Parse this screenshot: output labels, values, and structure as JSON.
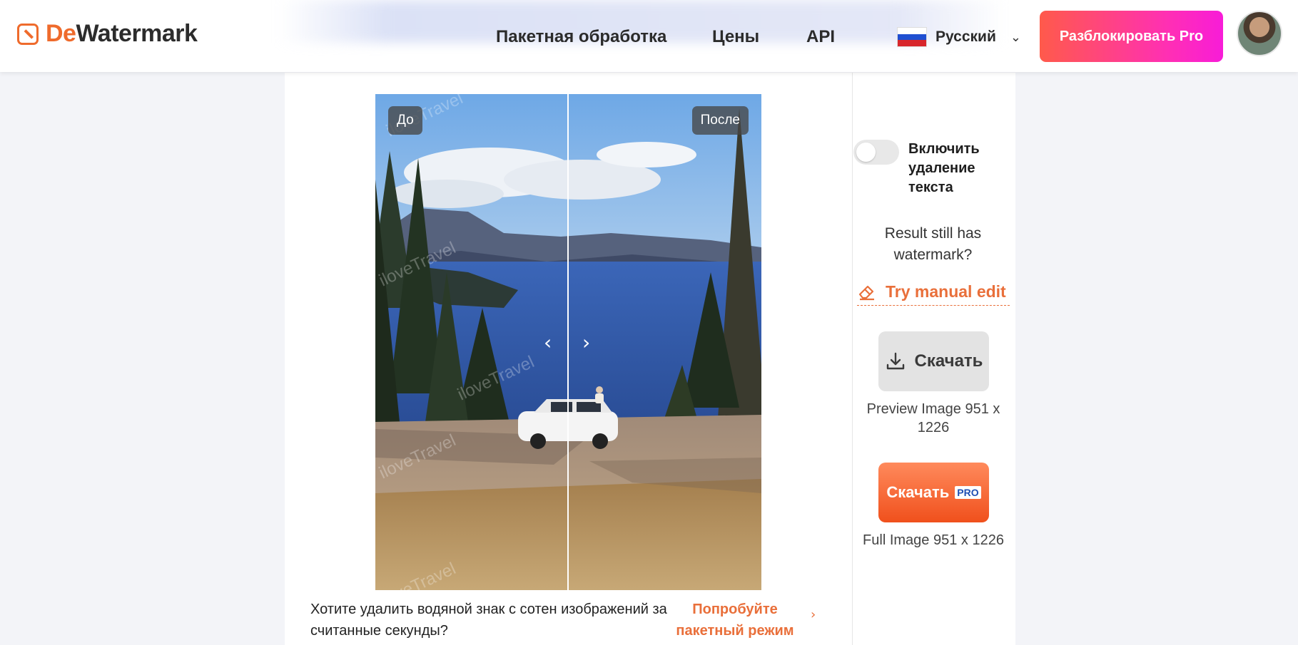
{
  "header": {
    "logo": {
      "part1": "De",
      "part2": "Watermark"
    },
    "nav": [
      {
        "label": "Пакетная обработка"
      },
      {
        "label": "Цены"
      },
      {
        "label": "API"
      }
    ],
    "language": {
      "label": "Русский"
    },
    "unlock_label": "Разблокировать Pro"
  },
  "compare": {
    "before_label": "До",
    "after_label": "После",
    "watermark_text": "iloveTravel"
  },
  "promo": {
    "text": "Хотите удалить водяной знак с сотен изображений за считанные секунды?",
    "link": "Попробуйте пакетный режим"
  },
  "sidebar": {
    "toggle_label": "Включить удаление текста",
    "still_text": "Result still has watermark?",
    "manual_edit_label": "Try manual edit",
    "download_label": "Скачать",
    "preview_caption": "Preview Image 951 x 1226",
    "download_pro_label": "Скачать",
    "pro_tag": "PRO",
    "full_caption": "Full Image 951 x 1226"
  },
  "colors": {
    "accent": "#E96F3A",
    "pro_gradient_start": "#FF5A4B",
    "pro_gradient_end": "#F81CD8"
  }
}
